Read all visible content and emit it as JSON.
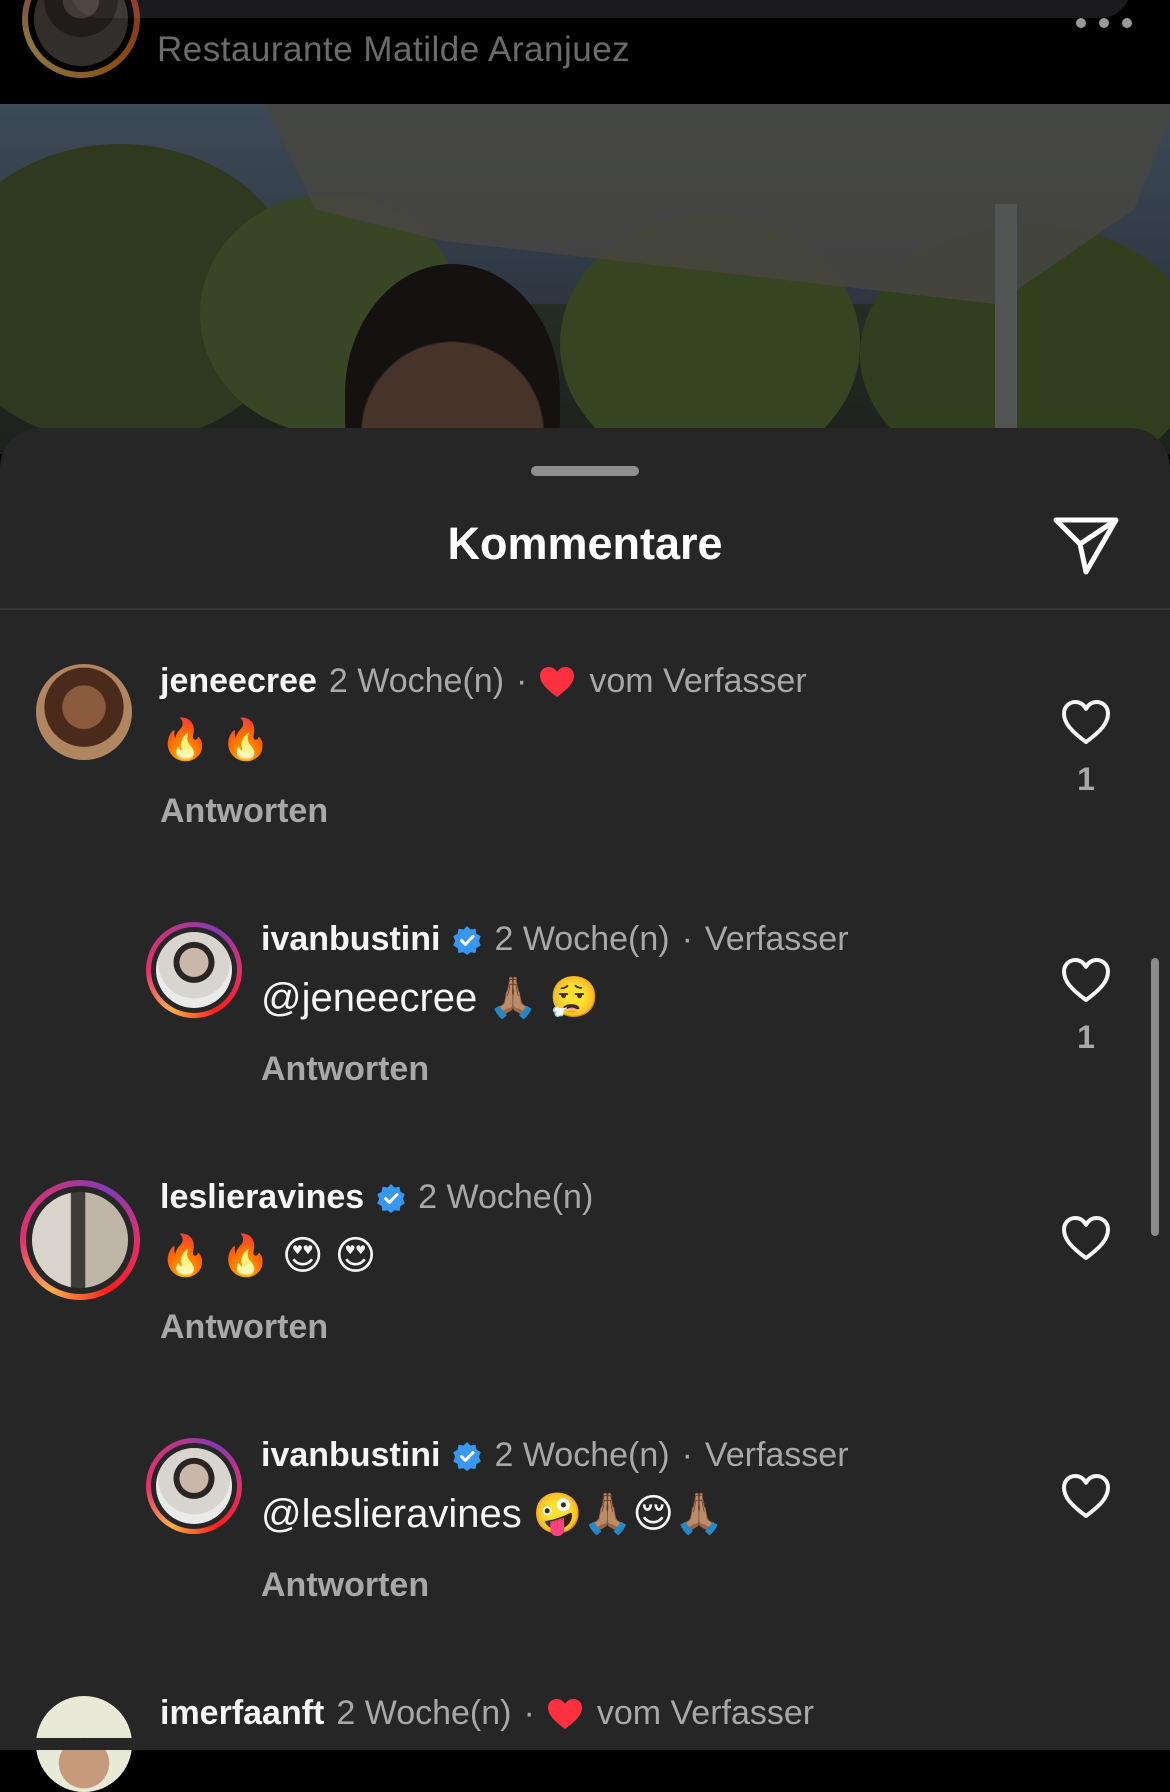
{
  "post": {
    "location": "Restaurante Matilde Aranjuez",
    "more_icon": "more-horizontal-icon"
  },
  "sheet": {
    "title": "Kommentare",
    "share_icon": "send-icon"
  },
  "colors": {
    "sheet_bg": "#262626",
    "verified_blue": "#3897f0",
    "heart_red": "#ff3040",
    "secondary_text": "#a8a8a8"
  },
  "comments": [
    {
      "username": "jeneecree",
      "time": "2 Woche(n)",
      "separator": "·",
      "liked_by_author": true,
      "author_label": "vom Verfasser",
      "text": "🔥 🔥",
      "reply_label": "Antworten",
      "like_count": "1"
    },
    {
      "username": "ivanbustini",
      "verified": true,
      "time": "2 Woche(n)",
      "separator": "·",
      "author_label": "Verfasser",
      "text": "@jeneecree 🙏🏽 😮‍💨",
      "reply_label": "Antworten",
      "like_count": "1"
    },
    {
      "username": "leslieravines",
      "verified": true,
      "time": "2 Woche(n)",
      "text": "🔥 🔥 😍 😍",
      "reply_label": "Antworten"
    },
    {
      "username": "ivanbustini",
      "verified": true,
      "time": "2 Woche(n)",
      "separator": "·",
      "author_label": "Verfasser",
      "text": "@leslieravines 🤪🙏🏽😌🙏🏽",
      "reply_label": "Antworten"
    },
    {
      "username": "imerfaanft",
      "time": "2 Woche(n)",
      "separator": "·",
      "liked_by_author": true,
      "author_label": "vom Verfasser"
    }
  ]
}
